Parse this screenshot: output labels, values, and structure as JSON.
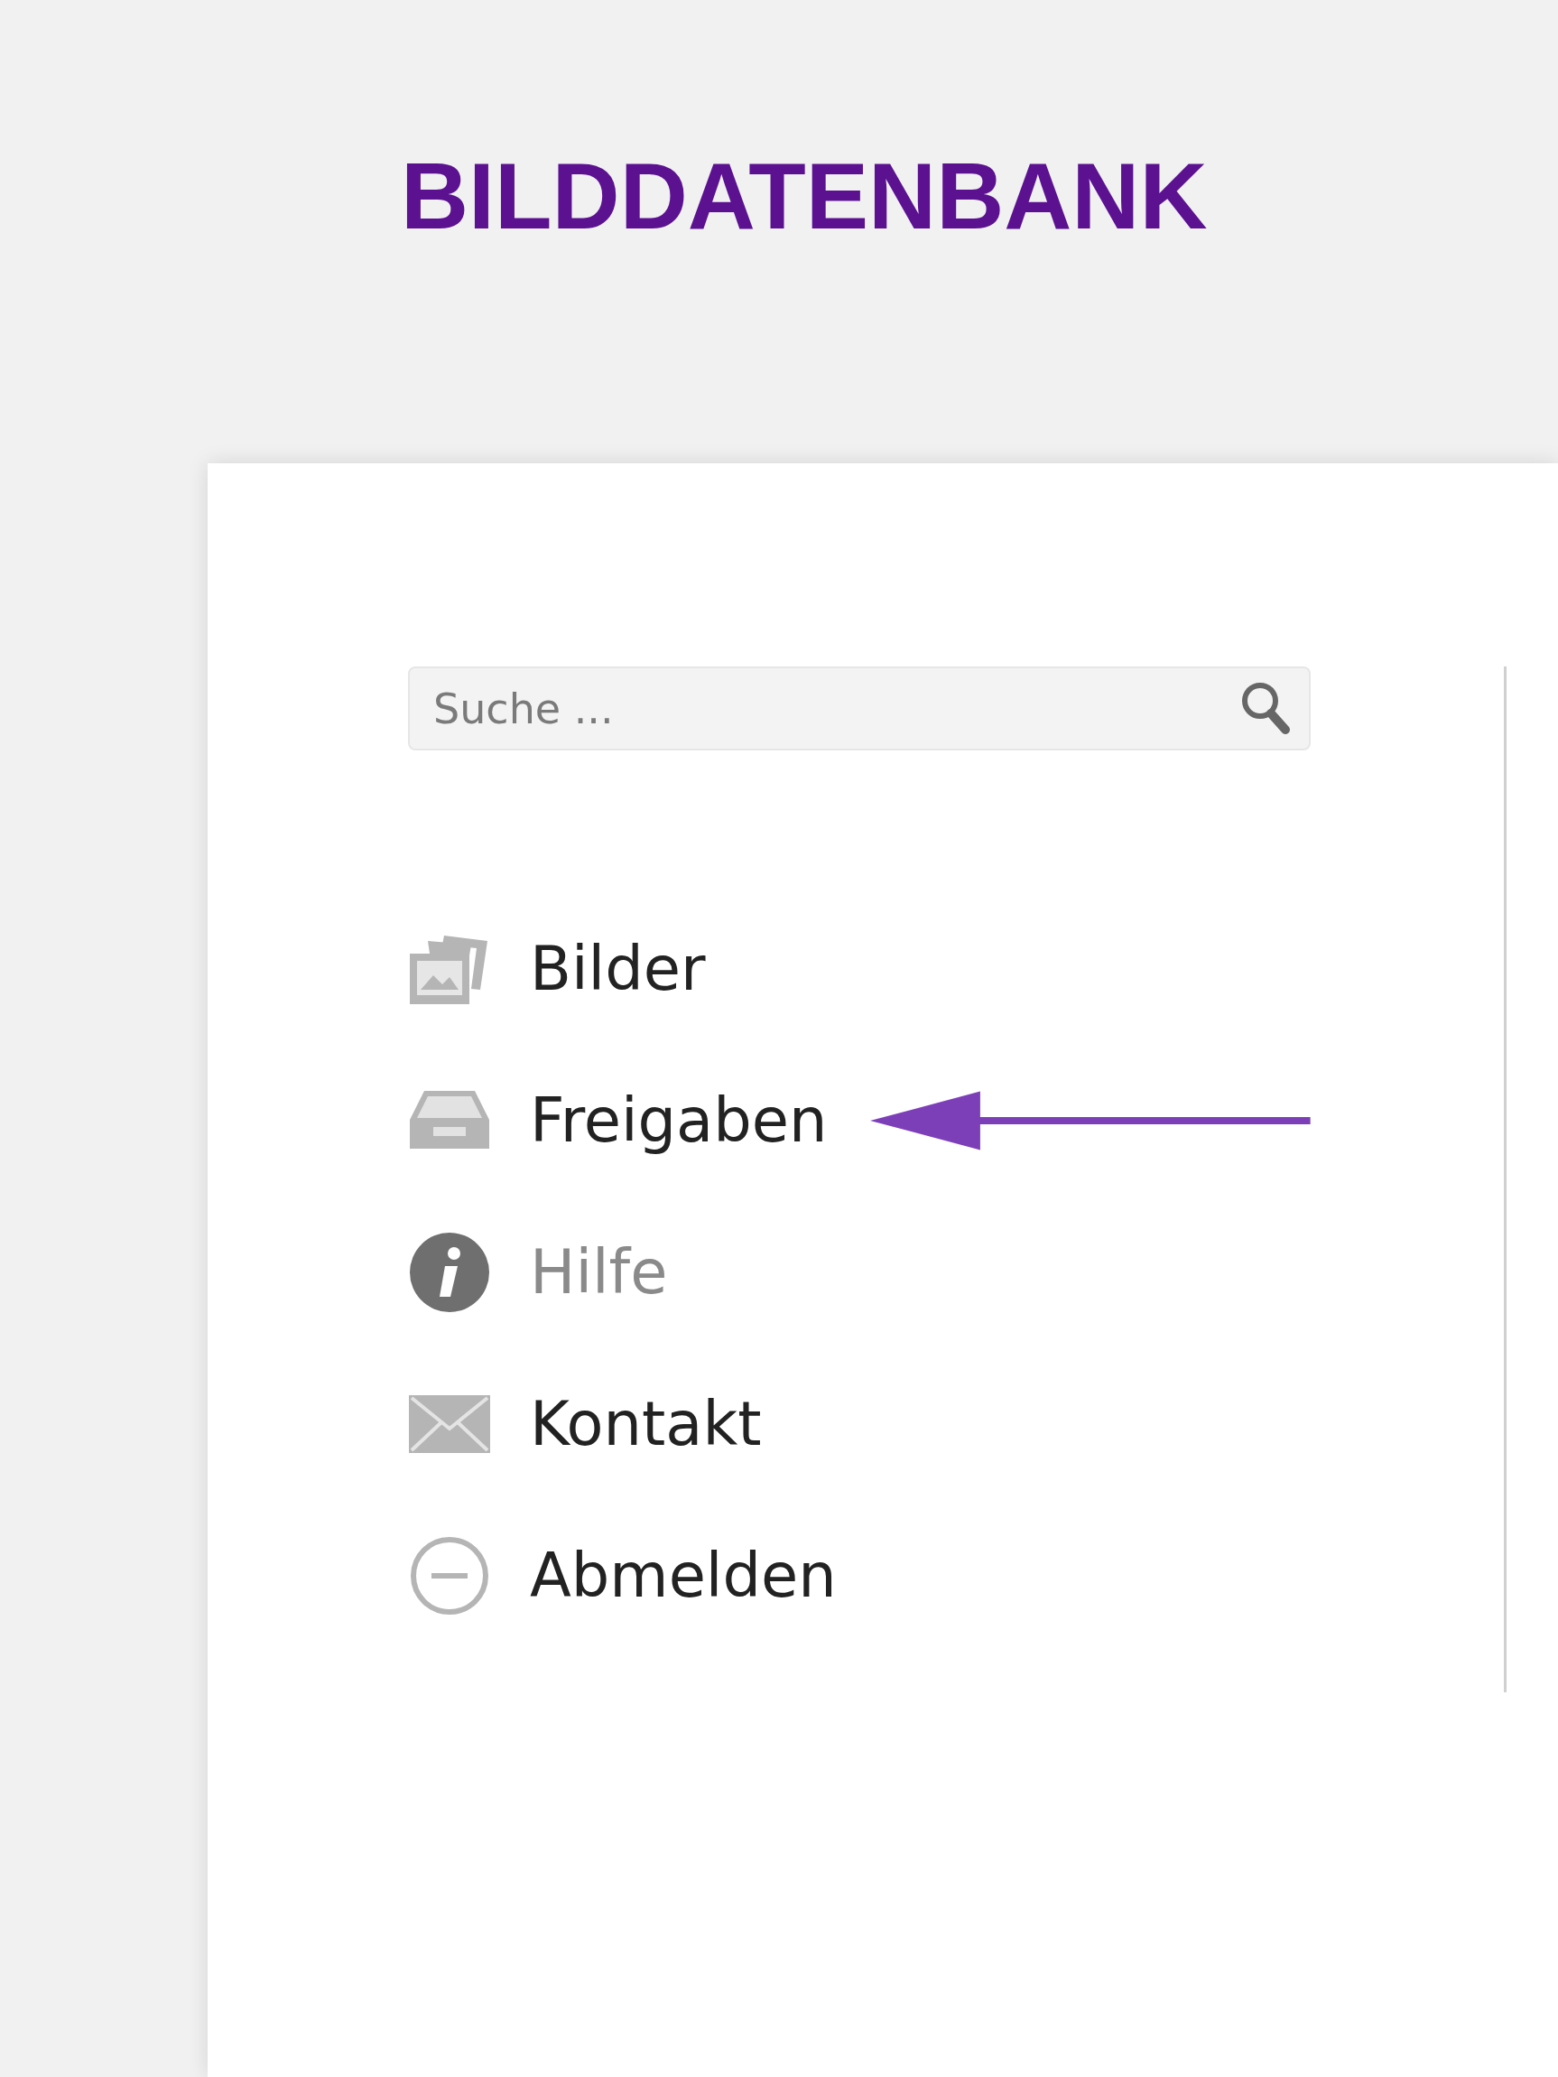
{
  "header": {
    "title": "BILDDATENBANK"
  },
  "search": {
    "placeholder": "Suche ..."
  },
  "menu": [
    {
      "label": "Bilder",
      "selected": false,
      "pointed": false
    },
    {
      "label": "Freigaben",
      "selected": false,
      "pointed": true
    },
    {
      "label": "Hilfe",
      "selected": true,
      "pointed": false
    },
    {
      "label": "Kontakt",
      "selected": false,
      "pointed": false
    },
    {
      "label": "Abmelden",
      "selected": false,
      "pointed": false
    }
  ]
}
